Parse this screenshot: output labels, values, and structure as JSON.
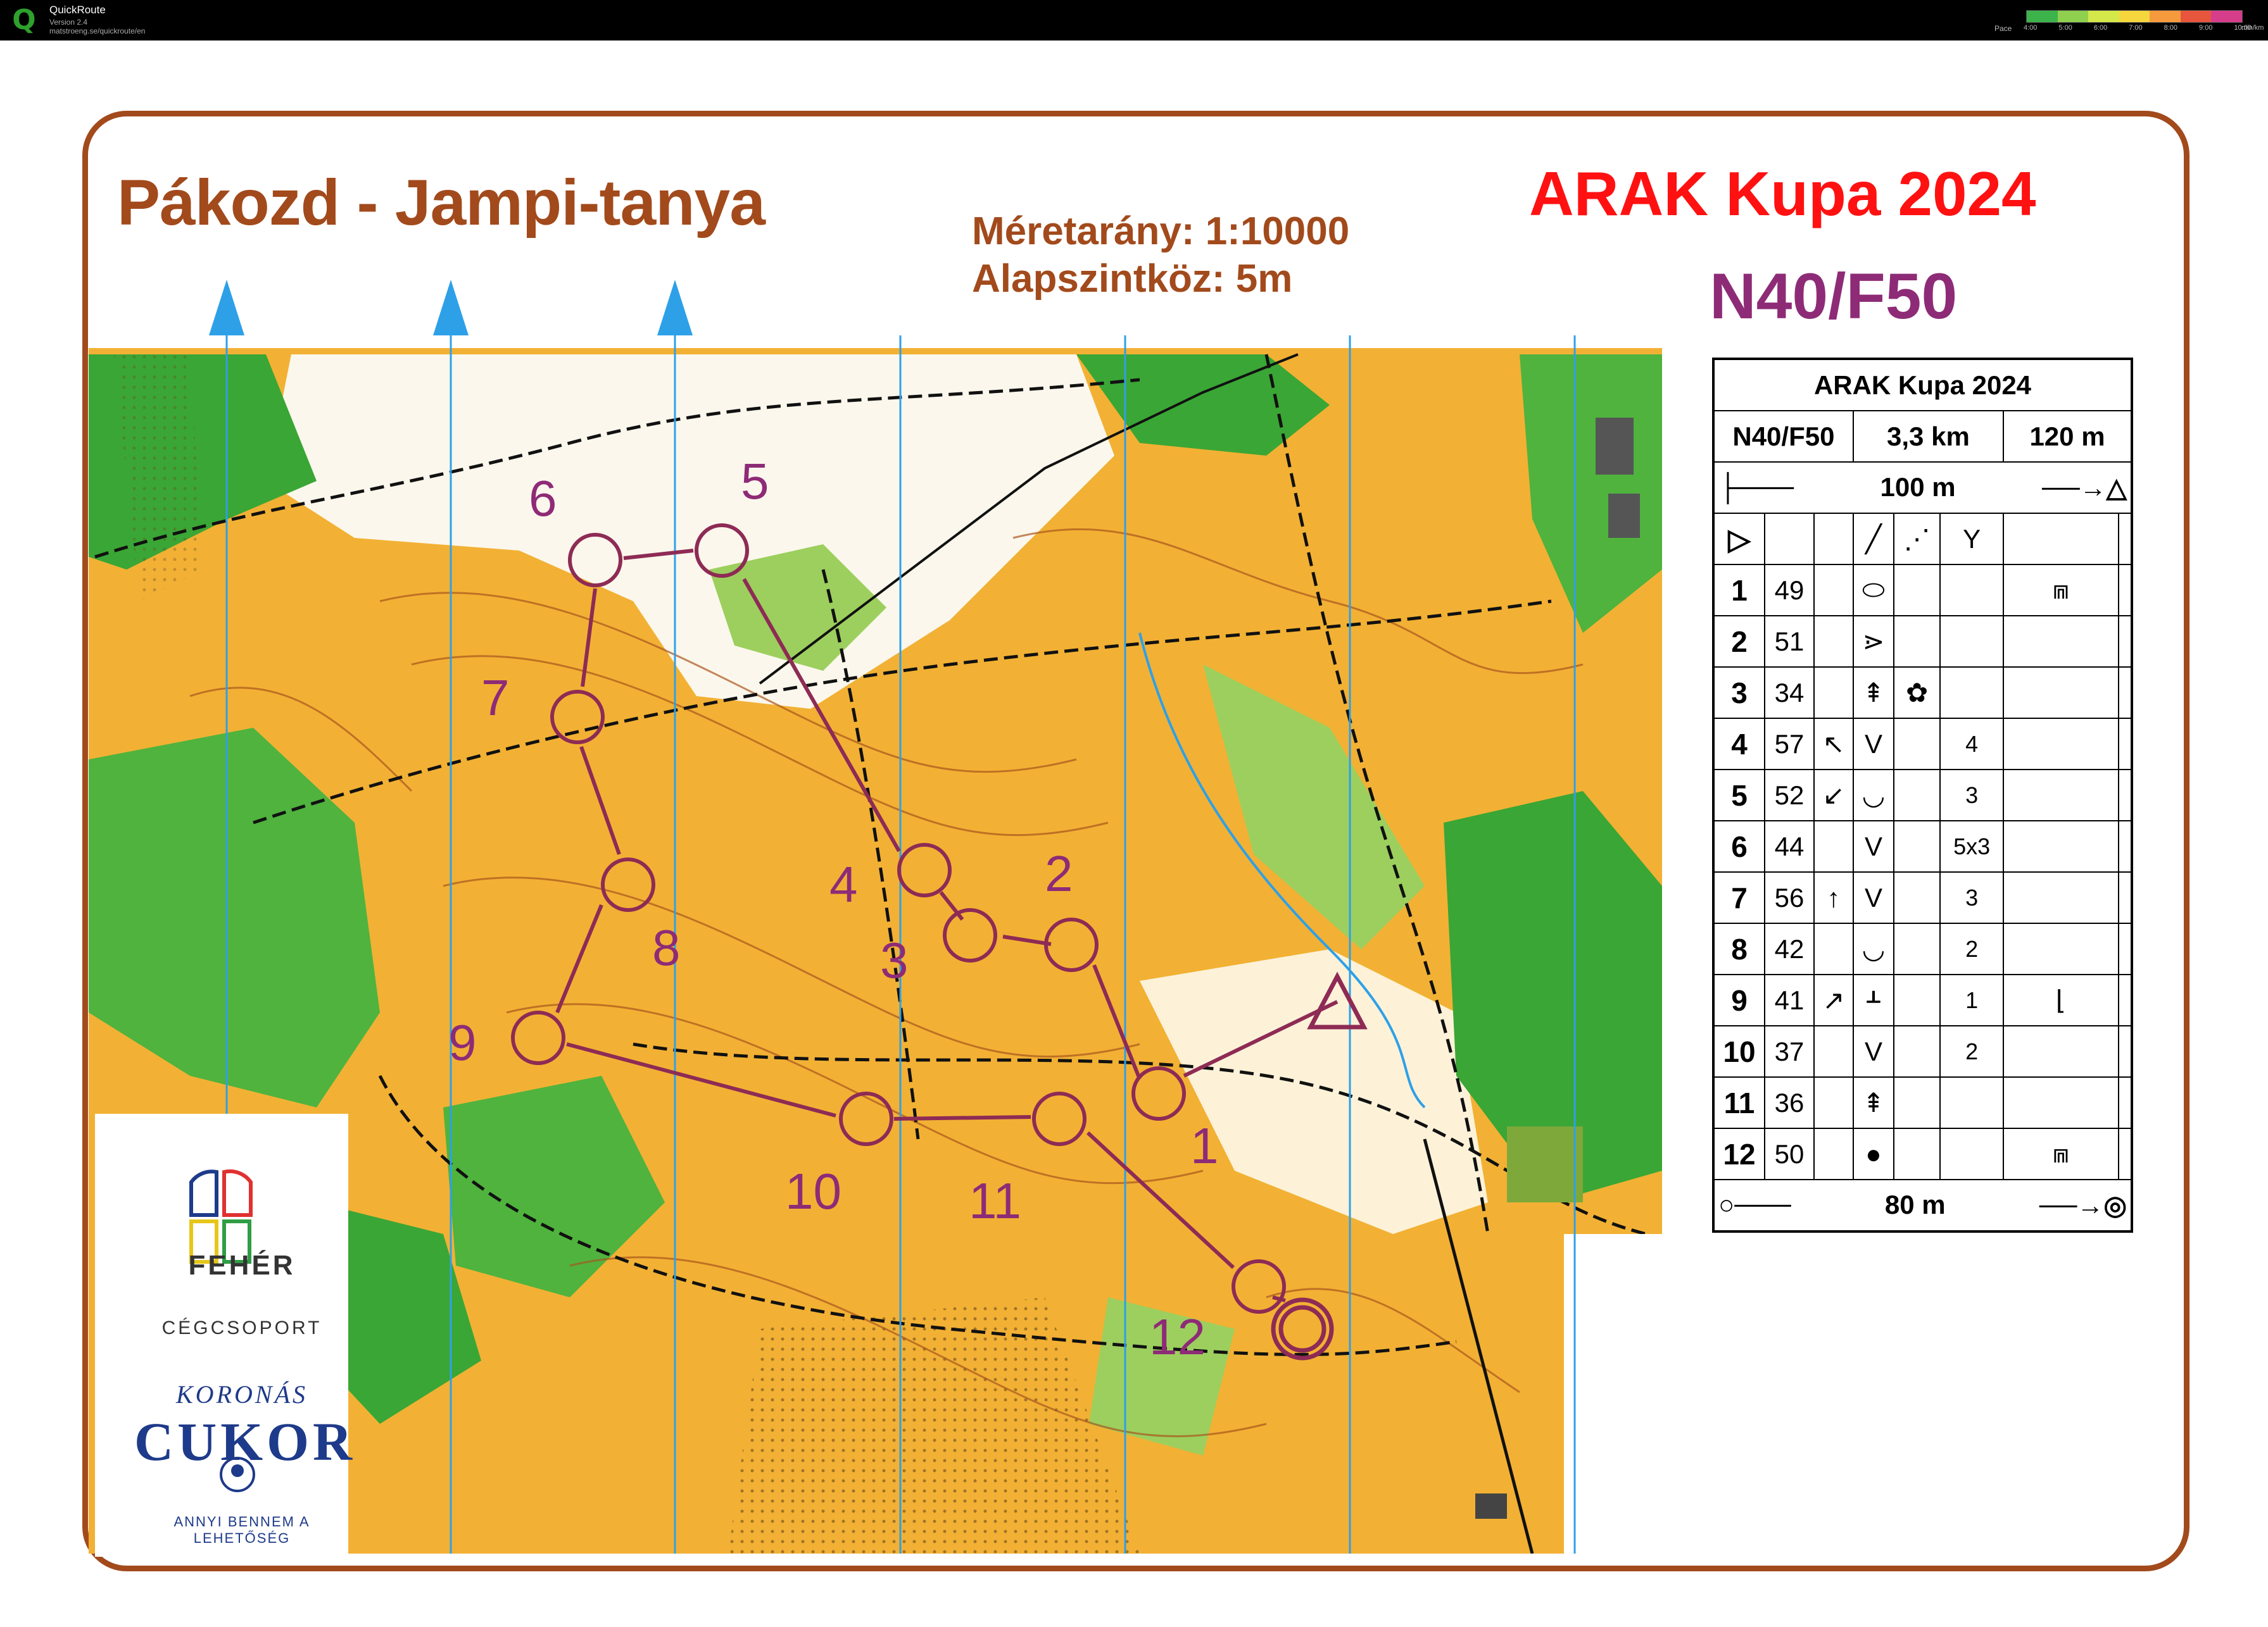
{
  "app": {
    "name": "QuickRoute",
    "version": "Version 2.4",
    "url": "matstroeng.se/quickroute/en",
    "pace_label": "Pace",
    "pace_ticks": [
      "4:00",
      "5:00",
      "6:00",
      "7:00",
      "8:00",
      "9:00",
      "10:00"
    ],
    "pace_unit": "min/km",
    "pace_colors": [
      "#3cb44b",
      "#8fd14f",
      "#d5e84a",
      "#f5d63d",
      "#f59b3d",
      "#e8553d",
      "#d63d8a"
    ]
  },
  "map": {
    "title": "Pákozd - Jampi-tanya",
    "scale_line": "Méretarány: 1:10000",
    "interval_line": "Alapszintköz: 5m",
    "event_title": "ARAK Kupa 2024",
    "category": "N40/F50",
    "colors": {
      "frame": "#a24a1c",
      "course": "#8e2b55",
      "event": "#ff1111",
      "category": "#8e2b77",
      "north_lines": "#2ea0e8",
      "terrain": "#f2b134",
      "forest": "#3aa635"
    },
    "control_labels": [
      "1",
      "2",
      "3",
      "4",
      "5",
      "6",
      "7",
      "8",
      "9",
      "10",
      "11",
      "12"
    ]
  },
  "description_card": {
    "title": "ARAK Kupa 2024",
    "category": "N40/F50",
    "length": "3,3 km",
    "climb": "120 m",
    "start_marking": "100 m",
    "finish_marking": "80 m",
    "controls": [
      {
        "num": "1",
        "code": "49",
        "c3": "",
        "c4": "ellipse",
        "c5": "",
        "c6": "",
        "c7": "tower"
      },
      {
        "num": "2",
        "code": "51",
        "c3": "",
        "c4": "dot-triangle",
        "c5": "",
        "c6": "",
        "c7": ""
      },
      {
        "num": "3",
        "code": "34",
        "c3": "",
        "c4": "tree",
        "c5": "flower",
        "c6": "",
        "c7": ""
      },
      {
        "num": "4",
        "code": "57",
        "c3": "arrow-nw",
        "c4": "v",
        "c5": "",
        "c6": "4",
        "c7": ""
      },
      {
        "num": "5",
        "code": "52",
        "c3": "arrow-sw",
        "c4": "u",
        "c5": "",
        "c6": "3",
        "c7": ""
      },
      {
        "num": "6",
        "code": "44",
        "c3": "",
        "c4": "v",
        "c5": "",
        "c6": "5x3",
        "c7": ""
      },
      {
        "num": "7",
        "code": "56",
        "c3": "arrow-n",
        "c4": "v",
        "c5": "",
        "c6": "3",
        "c7": ""
      },
      {
        "num": "8",
        "code": "42",
        "c3": "",
        "c4": "u",
        "c5": "",
        "c6": "2",
        "c7": ""
      },
      {
        "num": "9",
        "code": "41",
        "c3": "arrow-ne",
        "c4": "rake",
        "c5": "",
        "c6": "1",
        "c7": "corner"
      },
      {
        "num": "10",
        "code": "37",
        "c3": "",
        "c4": "v",
        "c5": "",
        "c6": "2",
        "c7": ""
      },
      {
        "num": "11",
        "code": "36",
        "c3": "",
        "c4": "tree",
        "c5": "",
        "c6": "",
        "c7": ""
      },
      {
        "num": "12",
        "code": "50",
        "c3": "",
        "c4": "dot",
        "c5": "",
        "c6": "",
        "c7": "tower"
      }
    ]
  },
  "sponsors": {
    "feher": "FEHÉR",
    "feher_sub": "CÉGCSOPORT",
    "koronas": "KORONÁS",
    "cukor": "CUKOR",
    "cukor_slogan": "ANNYI BENNEM A LEHETŐSÉG"
  }
}
